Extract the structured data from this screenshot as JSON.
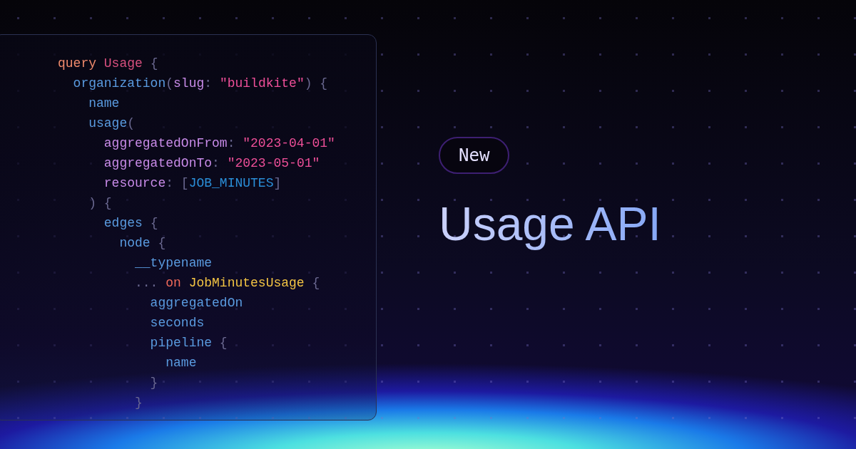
{
  "code_panel": {
    "lines": [
      {
        "tokens": [
          {
            "text": "query",
            "kind": "keyword"
          },
          {
            "text": " Usage",
            "kind": "typename"
          },
          {
            "text": " {",
            "kind": "punct"
          }
        ]
      },
      {
        "tokens": [
          {
            "text": "  organization",
            "kind": "field"
          },
          {
            "text": "(",
            "kind": "punct"
          },
          {
            "text": "slug",
            "kind": "argument"
          },
          {
            "text": ":",
            "kind": "punct"
          },
          {
            "text": " \"buildkite\"",
            "kind": "string"
          },
          {
            "text": ") {",
            "kind": "punct"
          }
        ]
      },
      {
        "tokens": [
          {
            "text": "    name",
            "kind": "field"
          }
        ]
      },
      {
        "tokens": [
          {
            "text": "    usage",
            "kind": "field"
          },
          {
            "text": "(",
            "kind": "punct"
          }
        ]
      },
      {
        "tokens": [
          {
            "text": "      aggregatedOnFrom",
            "kind": "argument"
          },
          {
            "text": ":",
            "kind": "punct"
          },
          {
            "text": " \"2023-04-01\"",
            "kind": "string"
          }
        ]
      },
      {
        "tokens": [
          {
            "text": "      aggregatedOnTo",
            "kind": "argument"
          },
          {
            "text": ":",
            "kind": "punct"
          },
          {
            "text": " \"2023-05-01\"",
            "kind": "string"
          }
        ]
      },
      {
        "tokens": [
          {
            "text": "      resource",
            "kind": "argument"
          },
          {
            "text": ": [",
            "kind": "punct"
          },
          {
            "text": "JOB_MINUTES",
            "kind": "enum"
          },
          {
            "text": "]",
            "kind": "punct"
          }
        ]
      },
      {
        "tokens": [
          {
            "text": "    ) {",
            "kind": "punct"
          }
        ]
      },
      {
        "tokens": [
          {
            "text": "      edges",
            "kind": "field"
          },
          {
            "text": " {",
            "kind": "punct"
          }
        ]
      },
      {
        "tokens": [
          {
            "text": "        node",
            "kind": "field"
          },
          {
            "text": " {",
            "kind": "punct"
          }
        ]
      },
      {
        "tokens": [
          {
            "text": "          __typename",
            "kind": "field"
          }
        ]
      },
      {
        "tokens": [
          {
            "text": "          ...",
            "kind": "punct"
          },
          {
            "text": " on",
            "kind": "keyword_on"
          },
          {
            "text": " JobMinutesUsage",
            "kind": "fragment_type"
          },
          {
            "text": " {",
            "kind": "punct"
          }
        ]
      },
      {
        "tokens": [
          {
            "text": "            aggregatedOn",
            "kind": "field"
          }
        ]
      },
      {
        "tokens": [
          {
            "text": "            seconds",
            "kind": "field"
          }
        ]
      },
      {
        "tokens": [
          {
            "text": "            pipeline",
            "kind": "field"
          },
          {
            "text": " {",
            "kind": "punct"
          }
        ]
      },
      {
        "tokens": [
          {
            "text": "              name",
            "kind": "field"
          }
        ]
      },
      {
        "tokens": [
          {
            "text": "            }",
            "kind": "punct"
          }
        ]
      },
      {
        "tokens": [
          {
            "text": "          }",
            "kind": "punct"
          }
        ]
      }
    ]
  },
  "badge": "New",
  "title": "Usage API"
}
